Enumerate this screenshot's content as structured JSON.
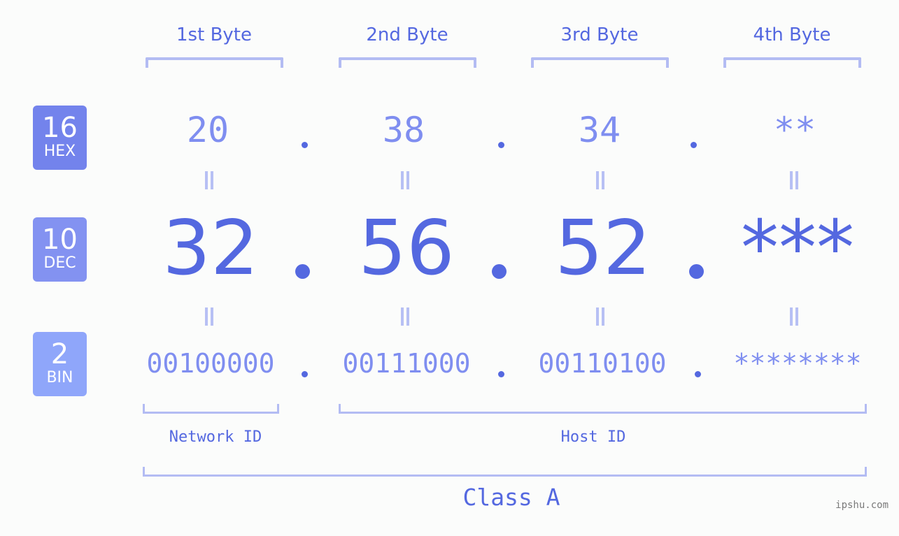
{
  "byte_headers": [
    "1st Byte",
    "2nd Byte",
    "3rd Byte",
    "4th Byte"
  ],
  "badges": {
    "hex": {
      "number": "16",
      "label": "HEX",
      "color": "#7383ec"
    },
    "dec": {
      "number": "10",
      "label": "DEC",
      "color": "#8392f1"
    },
    "bin": {
      "number": "2",
      "label": "BIN",
      "color": "#8fa6fa"
    }
  },
  "hex": [
    "20",
    "38",
    "34",
    "**"
  ],
  "dec": [
    "32",
    "56",
    "52",
    "***"
  ],
  "bin": [
    "00100000",
    "00111000",
    "00110100",
    "********"
  ],
  "separator": ".",
  "sections": {
    "network": "Network ID",
    "host": "Host ID",
    "class": "Class A"
  },
  "watermark": "ipshu.com",
  "colors": {
    "accent": "#5468e0",
    "light_value": "#7f8ef0",
    "bracket": "#b3bcf3"
  }
}
